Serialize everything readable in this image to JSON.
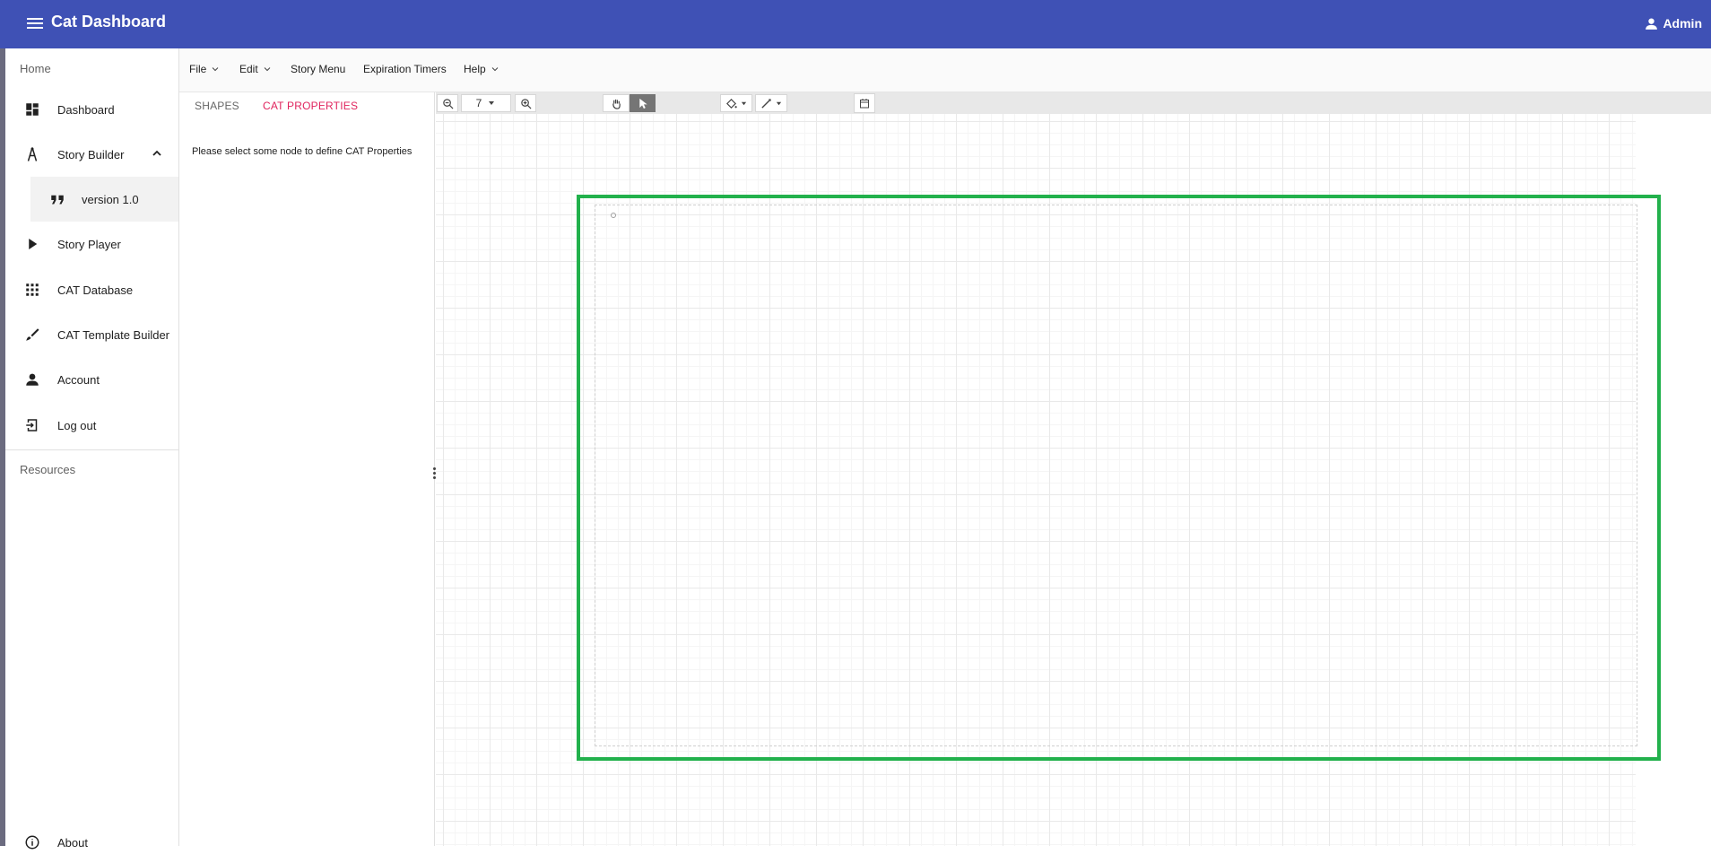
{
  "app": {
    "title": "Cat Dashboard",
    "user": "Admin"
  },
  "sidebar": {
    "home_heading": "Home",
    "items": [
      {
        "label": "Dashboard",
        "icon": "dashboard-icon"
      },
      {
        "label": "Story Builder",
        "icon": "compass-icon",
        "expanded": true
      },
      {
        "label": "version 1.0",
        "icon": "quote-icon"
      },
      {
        "label": "Story Player",
        "icon": "play-icon"
      },
      {
        "label": "CAT Database",
        "icon": "grid-apps-icon"
      },
      {
        "label": "CAT Template Builder",
        "icon": "brush-icon"
      },
      {
        "label": "Account",
        "icon": "person-icon"
      },
      {
        "label": "Log out",
        "icon": "logout-icon"
      }
    ],
    "resources_heading": "Resources",
    "about": "About"
  },
  "menubar": {
    "items": [
      "File",
      "Edit",
      "Story Menu",
      "Expiration Timers",
      "Help"
    ]
  },
  "panel": {
    "tabs": [
      "SHAPES",
      "CAT PROPERTIES"
    ],
    "active_tab": "CAT PROPERTIES",
    "message": "Please select some node to define CAT Properties"
  },
  "toolbar": {
    "zoom_level": "7"
  },
  "colors": {
    "appbar": "#3f51b5",
    "active_tab": "#e0245e",
    "highlight": "#22b14c"
  }
}
